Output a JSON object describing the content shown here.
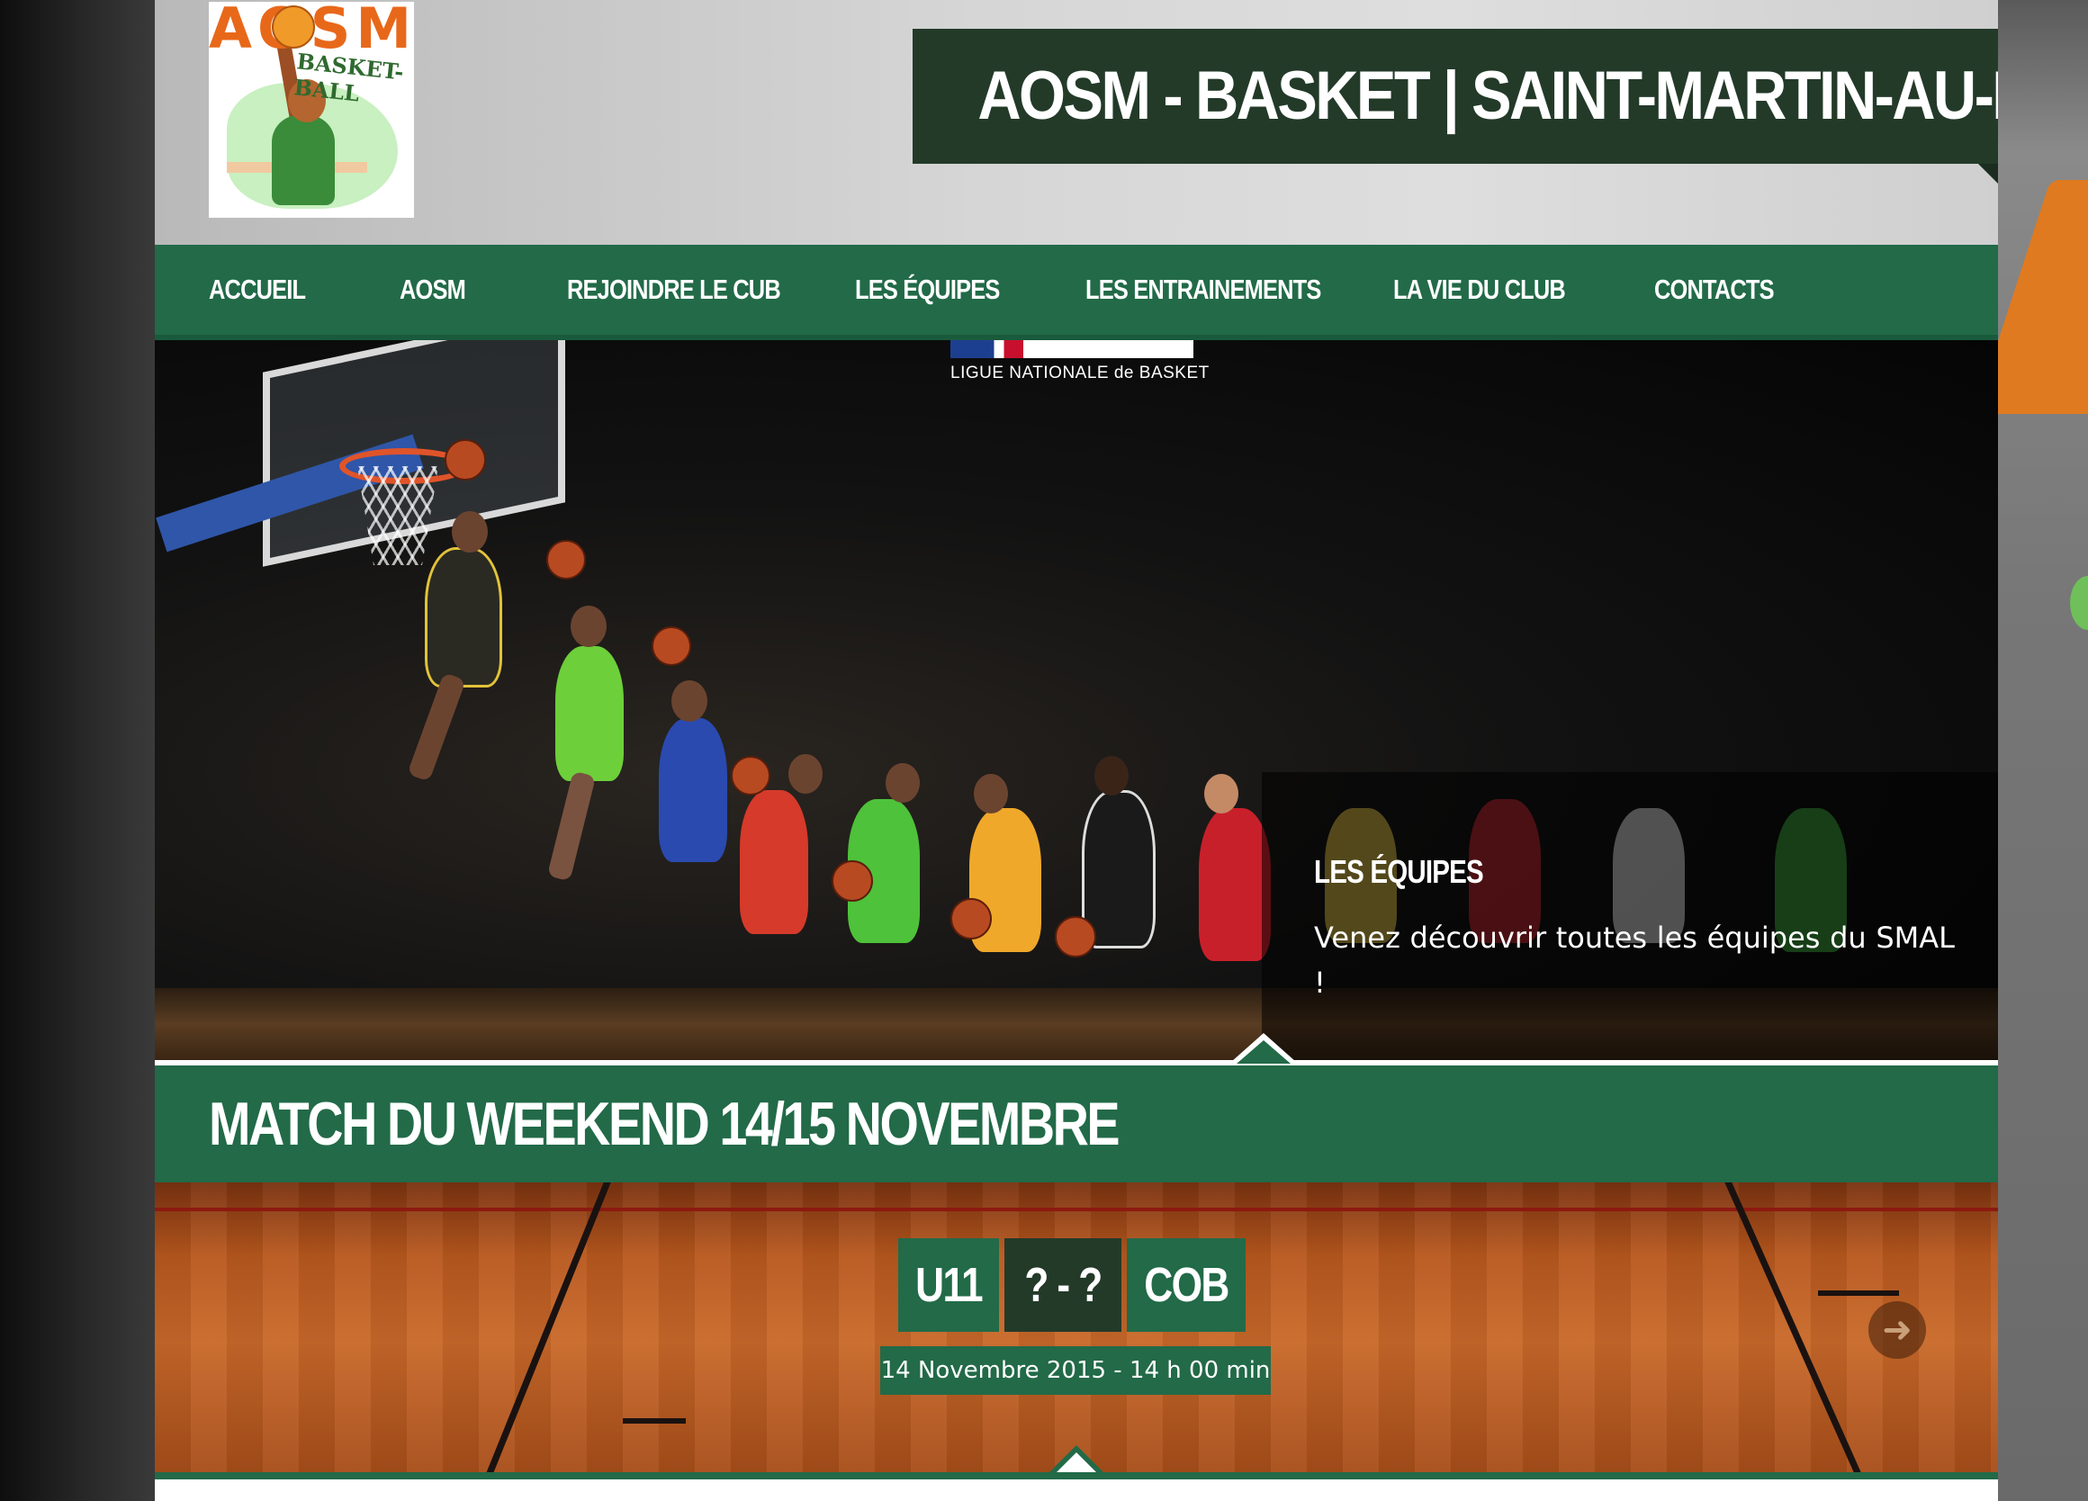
{
  "site": {
    "title": "AOSM - BASKET | SAINT-MARTIN-AU-LAËRT",
    "logo": {
      "letters": "AOSM",
      "subtitle": "BASKET-BALL"
    }
  },
  "nav": {
    "items": [
      {
        "label": "ACCUEIL"
      },
      {
        "label": "AOSM"
      },
      {
        "label": "REJOINDRE LE CUB"
      },
      {
        "label": "LES ÉQUIPES"
      },
      {
        "label": "LES ENTRAINEMENTS"
      },
      {
        "label": "LA VIE DU CLUB"
      },
      {
        "label": "CONTACTS"
      }
    ]
  },
  "slider": {
    "brand_text": "LIGUE NATIONALE de BASKET",
    "caption_title": "LES ÉQUIPES",
    "caption_text": "Venez découvrir toutes les équipes du SMAL",
    "caption_text_end": "!"
  },
  "match": {
    "section_title": "MATCH DU WEEKEND 14/15 NOVEMBRE",
    "home_team": "U11",
    "score": "? - ?",
    "away_team": "COB",
    "date": "14 Novembre 2015 - 14 h 00 min",
    "next_icon": "arrow-right-icon"
  },
  "colors": {
    "primary_green": "#226a48",
    "dark_green": "#233a29",
    "accent_orange": "#e8681a"
  }
}
